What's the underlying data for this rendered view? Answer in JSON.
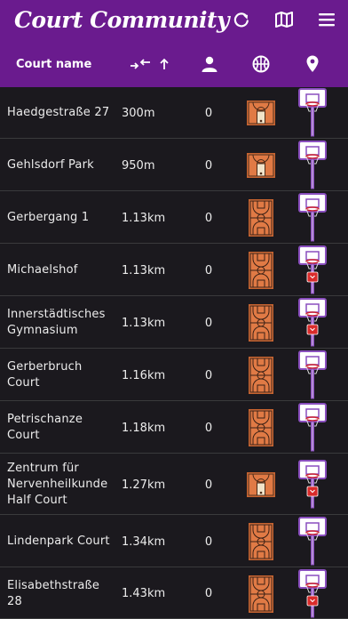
{
  "app": {
    "title": "Court Community"
  },
  "toolbar": {
    "refresh_icon": "refresh-icon",
    "map_icon": "map-icon",
    "menu_icon": "menu-icon"
  },
  "header": {
    "court_name_label": "Court name",
    "sort_icon": "swap-arrows-icon",
    "sort_dir_icon": "arrow-up-icon",
    "players_icon": "person-icon",
    "surface_icon": "basketball-icon",
    "location_icon": "map-pin-icon"
  },
  "colors": {
    "appbar": "#6a1b8e",
    "background": "#1b191e",
    "accent_court": "#e07a45",
    "hoop": "#8a4fbf"
  },
  "rows": [
    {
      "name": "Haedgestraße 27",
      "distance": "300m",
      "count": "0",
      "court_type": "half-court",
      "hoop_type": "plain"
    },
    {
      "name": "Gehlsdorf Park",
      "distance": "950m",
      "count": "0",
      "court_type": "half-court",
      "hoop_type": "plain"
    },
    {
      "name": "Gerbergang 1",
      "distance": "1.13km",
      "count": "0",
      "court_type": "full-court",
      "hoop_type": "plain"
    },
    {
      "name": "Michaelshof",
      "distance": "1.13km",
      "count": "0",
      "court_type": "full-court",
      "hoop_type": "with-net"
    },
    {
      "name": "Innerstädtisches Gymnasium",
      "distance": "1.13km",
      "count": "0",
      "court_type": "full-court",
      "hoop_type": "with-net"
    },
    {
      "name": "Gerberbruch Court",
      "distance": "1.16km",
      "count": "0",
      "court_type": "full-court",
      "hoop_type": "plain"
    },
    {
      "name": "Petrischanze Court",
      "distance": "1.18km",
      "count": "0",
      "court_type": "full-court",
      "hoop_type": "plain"
    },
    {
      "name": "Zentrum für Nervenheilkunde Half Court",
      "distance": "1.27km",
      "count": "0",
      "court_type": "half-court",
      "hoop_type": "with-net"
    },
    {
      "name": "Lindenpark Court",
      "distance": "1.34km",
      "count": "0",
      "court_type": "full-court",
      "hoop_type": "plain"
    },
    {
      "name": "Elisabethstraße 28",
      "distance": "1.43km",
      "count": "0",
      "court_type": "full-court",
      "hoop_type": "with-net"
    }
  ]
}
